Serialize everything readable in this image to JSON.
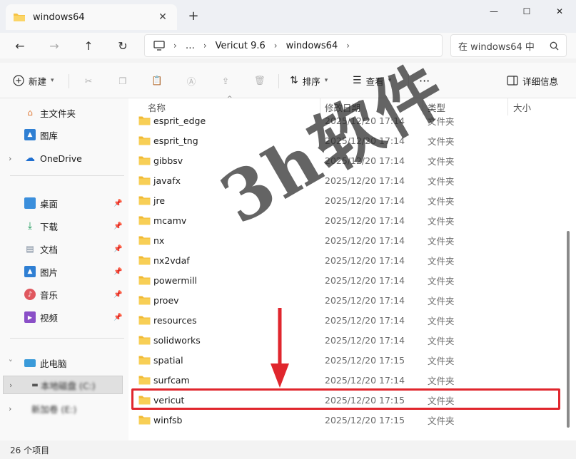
{
  "window": {
    "tab_title": "windows64",
    "new_tab": "+",
    "minimize": "—",
    "maximize": "☐",
    "close": "✕"
  },
  "nav": {
    "back": "←",
    "forward": "→",
    "up": "↑",
    "refresh": "↻",
    "breadcrumb": [
      "…",
      "Vericut 9.6",
      "windows64"
    ],
    "search_placeholder": "在 windows64 中"
  },
  "toolbar": {
    "new_label": "新建",
    "sort_label": "排序",
    "view_label": "查看",
    "more_label": "···",
    "details_label": "详细信息"
  },
  "sidebar": {
    "home": "主文件夹",
    "gallery": "图库",
    "onedrive": "OneDrive",
    "desktop": "桌面",
    "downloads": "下载",
    "documents": "文档",
    "pictures": "图片",
    "music": "音乐",
    "videos": "视频",
    "thispc": "此电脑",
    "drive_c": "本地磁盘 (C:)",
    "drive_e": "新加卷 (E:)"
  },
  "columns": {
    "name": "名称",
    "date": "修改日期",
    "type": "类型",
    "size": "大小"
  },
  "files": [
    {
      "name": "esprit_edge",
      "date": "2025/12/20 17:14",
      "type": "文件夹"
    },
    {
      "name": "esprit_tng",
      "date": "2025/12/20 17:14",
      "type": "文件夹"
    },
    {
      "name": "gibbsv",
      "date": "2025/12/20 17:14",
      "type": "文件夹"
    },
    {
      "name": "javafx",
      "date": "2025/12/20 17:14",
      "type": "文件夹"
    },
    {
      "name": "jre",
      "date": "2025/12/20 17:14",
      "type": "文件夹"
    },
    {
      "name": "mcamv",
      "date": "2025/12/20 17:14",
      "type": "文件夹"
    },
    {
      "name": "nx",
      "date": "2025/12/20 17:14",
      "type": "文件夹"
    },
    {
      "name": "nx2vdaf",
      "date": "2025/12/20 17:14",
      "type": "文件夹"
    },
    {
      "name": "powermill",
      "date": "2025/12/20 17:14",
      "type": "文件夹"
    },
    {
      "name": "proev",
      "date": "2025/12/20 17:14",
      "type": "文件夹"
    },
    {
      "name": "resources",
      "date": "2025/12/20 17:14",
      "type": "文件夹"
    },
    {
      "name": "solidworks",
      "date": "2025/12/20 17:14",
      "type": "文件夹"
    },
    {
      "name": "spatial",
      "date": "2025/12/20 17:15",
      "type": "文件夹"
    },
    {
      "name": "surfcam",
      "date": "2025/12/20 17:14",
      "type": "文件夹"
    },
    {
      "name": "vericut",
      "date": "2025/12/20 17:15",
      "type": "文件夹"
    },
    {
      "name": "winfsb",
      "date": "2025/12/20 17:15",
      "type": "文件夹"
    }
  ],
  "status": {
    "count": "26 个项目"
  },
  "watermark": "3h软件",
  "colors": {
    "highlight": "#e0262d",
    "folder": "#f6c343"
  }
}
